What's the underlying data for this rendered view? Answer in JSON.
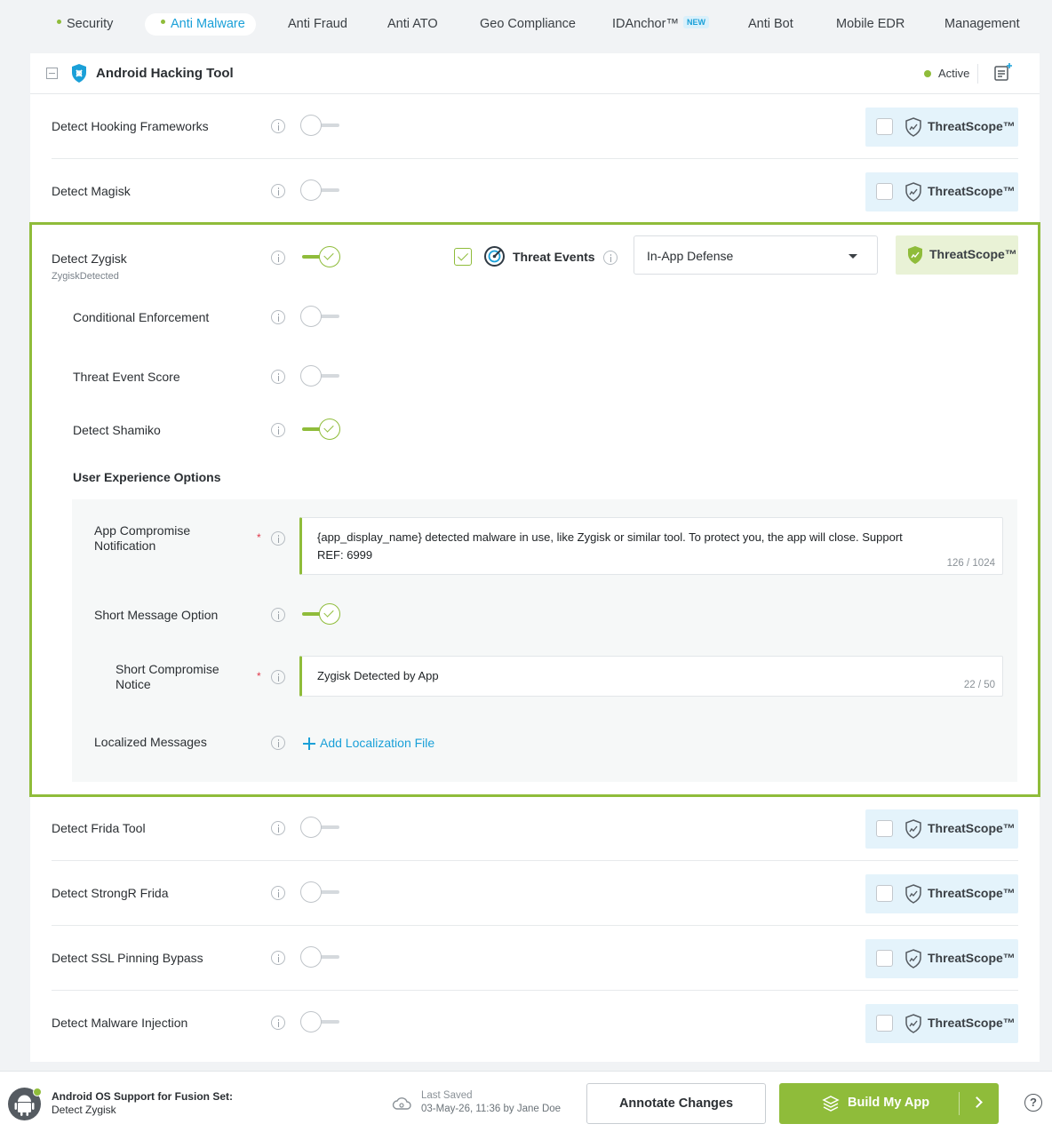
{
  "nav": {
    "tabs": [
      {
        "label": "Security",
        "dot": true,
        "active": false
      },
      {
        "label": "Anti Malware",
        "dot": true,
        "active": true
      },
      {
        "label": "Anti Fraud"
      },
      {
        "label": "Anti ATO"
      },
      {
        "label": "Geo Compliance"
      },
      {
        "label": "IDAnchor™",
        "badge": "NEW"
      },
      {
        "label": "Anti Bot"
      },
      {
        "label": "Mobile EDR"
      },
      {
        "label": "Management"
      }
    ]
  },
  "card": {
    "title": "Android Hacking Tool",
    "status": "Active",
    "status_color": "#8fbc3a"
  },
  "threatscope_label": "ThreatScope™",
  "rows_top": [
    {
      "label": "Detect Hooking Frameworks",
      "enabled": false
    },
    {
      "label": "Detect Magisk",
      "enabled": false
    }
  ],
  "zygisk": {
    "label": "Detect Zygisk",
    "event_id": "ZygiskDetected",
    "enabled": true,
    "threat_events_label": "Threat Events",
    "threat_events_checked": true,
    "response_select": "In-App Defense",
    "sub_options": [
      {
        "label": "Conditional Enforcement",
        "enabled": false
      },
      {
        "label": "Threat Event Score",
        "enabled": false
      },
      {
        "label": "Detect Shamiko",
        "enabled": true
      }
    ],
    "ux_title": "User Experience Options",
    "ux": {
      "notification_label": "App Compromise Notification",
      "notification_value": "{app_display_name} detected malware in use, like Zygisk or similar tool. To protect you, the app will close. Support\nREF: 6999",
      "notification_count": "126 / 1024",
      "short_msg_label": "Short Message Option",
      "short_msg_enabled": true,
      "short_notice_label": "Short Compromise Notice",
      "short_notice_value": "Zygisk Detected by App",
      "short_notice_count": "22 / 50",
      "localized_label": "Localized Messages",
      "add_localization": "Add Localization File",
      "required_mark": "*"
    }
  },
  "rows_bottom": [
    {
      "label": "Detect Frida Tool",
      "enabled": false
    },
    {
      "label": "Detect StrongR Frida",
      "enabled": false
    },
    {
      "label": "Detect SSL Pinning Bypass",
      "enabled": false
    },
    {
      "label": "Detect Malware Injection",
      "enabled": false
    }
  ],
  "footer": {
    "title": "Android OS Support for Fusion Set:",
    "subtitle": "Detect Zygisk",
    "saved_label": "Last Saved",
    "saved_value": "03-May-26, 11:36 by Jane Doe",
    "annotate_label": "Annotate Changes",
    "build_label": "Build My App",
    "help": "?"
  },
  "colors": {
    "accent_green": "#8fbc3a",
    "link_blue": "#1aa0d8",
    "threatscope_bg": "#e4f3fb"
  }
}
